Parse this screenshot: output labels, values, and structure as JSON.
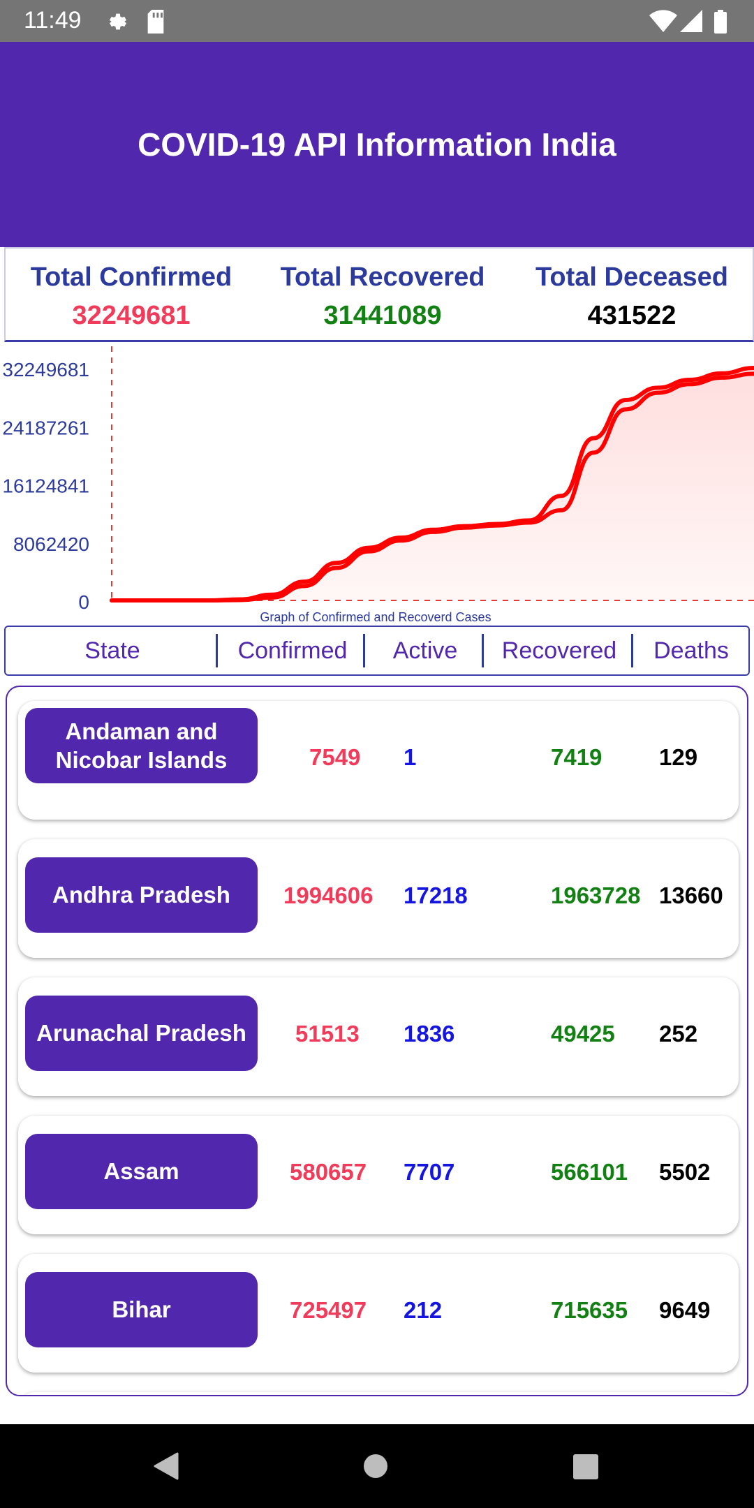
{
  "status_bar": {
    "time": "11:49"
  },
  "app_bar": {
    "title": "COVID-19 API Information India"
  },
  "totals": {
    "confirmed": {
      "label": "Total Confirmed",
      "value": "32249681",
      "color": "#f03c5a"
    },
    "recovered": {
      "label": "Total Recovered",
      "value": "31441089",
      "color": "#128012"
    },
    "deceased": {
      "label": "Total Deceased",
      "value": "431522",
      "color": "#000000"
    }
  },
  "chart_data": {
    "type": "area",
    "caption": "Graph of Confirmed and Recoverd Cases",
    "y_ticks": [
      "0",
      "8062420",
      "16124841",
      "24187261",
      "32249681"
    ],
    "ylim": [
      0,
      32249681
    ],
    "x": [
      0,
      5,
      10,
      15,
      20,
      25,
      30,
      35,
      40,
      45,
      50,
      55,
      60,
      65,
      70,
      75,
      80,
      85,
      90,
      95,
      100
    ],
    "series": [
      {
        "values": [
          0,
          0,
          0,
          0,
          150000,
          800000,
          2600000,
          5200000,
          7300000,
          8700000,
          9800000,
          10300000,
          10600000,
          11100000,
          14500000,
          22500000,
          27800000,
          29500000,
          30600000,
          31500000,
          32249681
        ],
        "color": "#ff0000"
      },
      {
        "values": [
          0,
          0,
          0,
          0,
          50000,
          400000,
          2000000,
          4500000,
          6800000,
          8300000,
          9500000,
          10100000,
          10400000,
          10800000,
          12500000,
          20500000,
          26500000,
          28800000,
          30000000,
          30900000,
          31441089
        ],
        "color": "#ff0000"
      }
    ],
    "fill_color": "#ffdede",
    "grid": false
  },
  "table": {
    "headers": {
      "state": "State",
      "confirmed": "Confirmed",
      "active": "Active",
      "recovered": "Recovered",
      "deaths": "Deaths"
    },
    "rows": [
      {
        "state": "Andaman and Nicobar Islands",
        "confirmed": "7549",
        "active": "1",
        "recovered": "7419",
        "deaths": "129"
      },
      {
        "state": "Andhra Pradesh",
        "confirmed": "1994606",
        "active": "17218",
        "recovered": "1963728",
        "deaths": "13660"
      },
      {
        "state": "Arunachal Pradesh",
        "confirmed": "51513",
        "active": "1836",
        "recovered": "49425",
        "deaths": "252"
      },
      {
        "state": "Assam",
        "confirmed": "580657",
        "active": "7707",
        "recovered": "566101",
        "deaths": "5502"
      },
      {
        "state": "Bihar",
        "confirmed": "725497",
        "active": "212",
        "recovered": "715635",
        "deaths": "9649"
      }
    ]
  },
  "colors": {
    "primary": "#5127ad",
    "confirmed": "#f03c5a",
    "active": "#1515e0",
    "recovered": "#128012",
    "deaths": "#000000"
  }
}
